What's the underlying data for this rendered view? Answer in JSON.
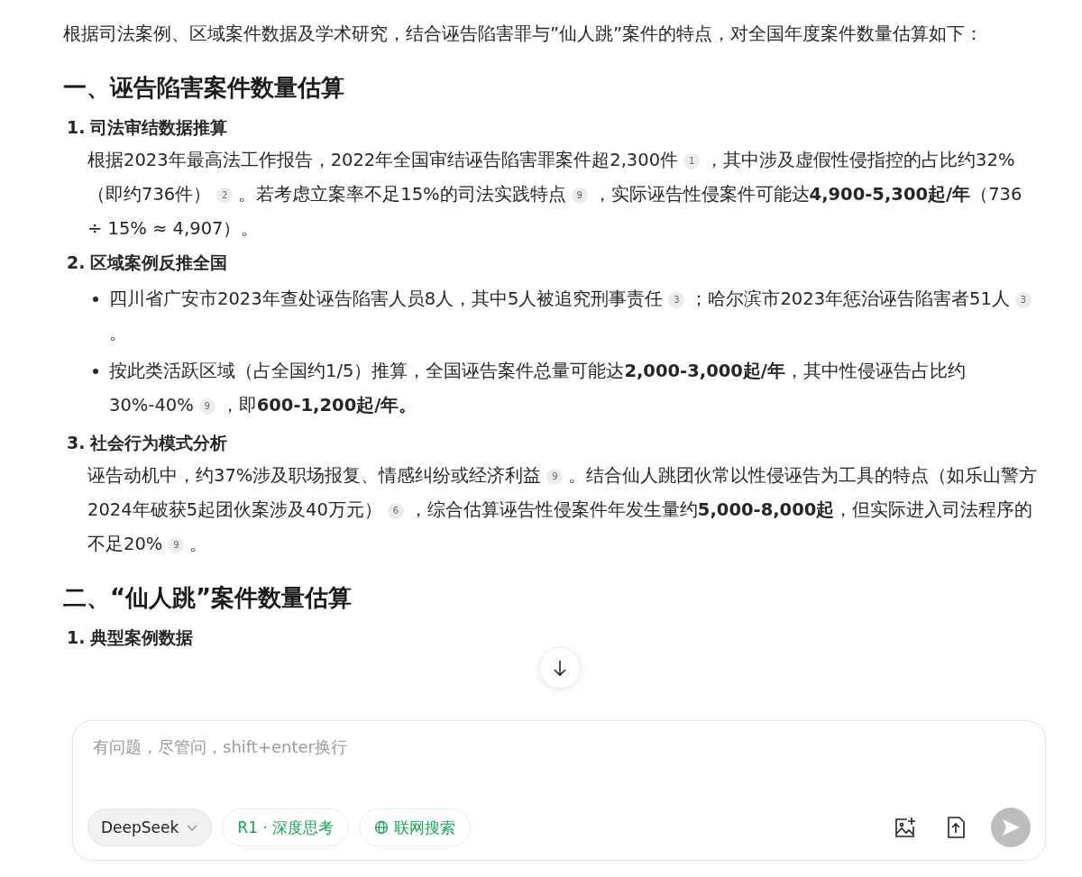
{
  "intro": "根据司法案例、区域案件数据及学术研究，结合诬告陷害罪与”仙人跳”案件的特点，对全国年度案件数量估算如下：",
  "sections": [
    {
      "heading": "一、诬告陷害案件数量估算",
      "items": [
        {
          "number": "1.",
          "title": "司法审结数据推算",
          "blocks": [
            {
              "kind": "paragraph",
              "parts": [
                {
                  "kind": "text",
                  "text": "根据2023年最高法工作报告，2022年全国审结诬告陷害罪案件超2,300件"
                },
                {
                  "kind": "cite",
                  "text": "1"
                },
                {
                  "kind": "text",
                  "text": "，其中涉及虚假性侵指控的占比约32%（即约736件）"
                },
                {
                  "kind": "cite",
                  "text": "2"
                },
                {
                  "kind": "text",
                  "text": "。若考虑立案率不足15%的司法实践特点"
                },
                {
                  "kind": "cite",
                  "text": "9"
                },
                {
                  "kind": "text",
                  "text": "，实际诬告性侵案件可能达**4,900-5,300起/年**（736 ÷ 15% ≈ 4,907）。"
                }
              ]
            }
          ]
        },
        {
          "number": "2.",
          "title": "区域案例反推全国",
          "blocks": [
            {
              "kind": "bullet",
              "parts": [
                {
                  "kind": "text",
                  "text": "四川省广安市2023年查处诬告陷害人员8人，其中5人被追究刑事责任"
                },
                {
                  "kind": "cite",
                  "text": "3"
                },
                {
                  "kind": "text",
                  "text": "；哈尔滨市2023年惩治诬告陷害者51人"
                },
                {
                  "kind": "cite",
                  "text": "3"
                },
                {
                  "kind": "text",
                  "text": "。"
                }
              ]
            },
            {
              "kind": "bullet",
              "parts": [
                {
                  "kind": "text",
                  "text": "按此类活跃区域（占全国约1/5）推算，全国诬告案件总量可能达**2,000-3,000起/年**，其中性侵诬告占比约30%-40%"
                },
                {
                  "kind": "cite",
                  "text": "9"
                },
                {
                  "kind": "text",
                  "text": "，即**600-1,200起/年。**"
                }
              ]
            }
          ]
        },
        {
          "number": "3.",
          "title": "社会行为模式分析",
          "blocks": [
            {
              "kind": "paragraph",
              "parts": [
                {
                  "kind": "text",
                  "text": "诬告动机中，约37%涉及职场报复、情感纠纷或经济利益"
                },
                {
                  "kind": "cite",
                  "text": "9"
                },
                {
                  "kind": "text",
                  "text": "。结合仙人跳团伙常以性侵诬告为工具的特点（如乐山警方2024年破获5起团伙案涉及40万元）"
                },
                {
                  "kind": "cite",
                  "text": "6"
                },
                {
                  "kind": "text",
                  "text": "，综合估算诬告性侵案件年发生量约**5,000-8,000起**，但实际进入司法程序的不足20%"
                },
                {
                  "kind": "cite",
                  "text": "9"
                },
                {
                  "kind": "text",
                  "text": "。"
                }
              ]
            }
          ]
        }
      ]
    },
    {
      "heading": "二、“仙人跳”案件数量估算",
      "items": [
        {
          "number": "1.",
          "title": "典型案例数据"
        }
      ]
    }
  ],
  "composer": {
    "placeholder": "有问题，尽管问，shift+enter换行",
    "model": "DeepSeek",
    "toggles": [
      {
        "kind": "think",
        "label": "R1 · 深度思考",
        "selected": true
      },
      {
        "kind": "web",
        "label": "联网搜索",
        "selected": true
      }
    ],
    "send_disabled": true
  }
}
